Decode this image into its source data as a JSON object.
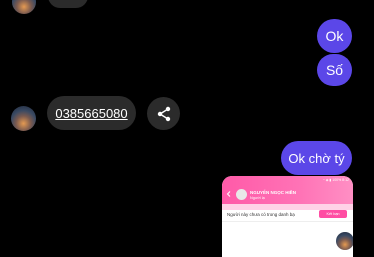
{
  "messages": {
    "ok": "Ok",
    "so": "Số",
    "phone_number": "0385665080",
    "ok_cho_ty": "Ok chờ tý"
  },
  "thumbnail": {
    "status": "◔ ◈ ▮ 100% 8:12",
    "contact_name": "NGUYỄN NGỌC HIỀN",
    "contact_status": "Người lạ",
    "notice": "Người này chưa có trong danh bạ",
    "add_friend_label": "Kết bạn"
  },
  "colors": {
    "background": "#000000",
    "outgoing_bubble": "#5b47e8",
    "incoming_bubble": "#2b2b2b",
    "thumbnail_header": "#ff5aa8"
  },
  "icons": {
    "share": "share-icon",
    "back": "back-arrow-icon"
  }
}
